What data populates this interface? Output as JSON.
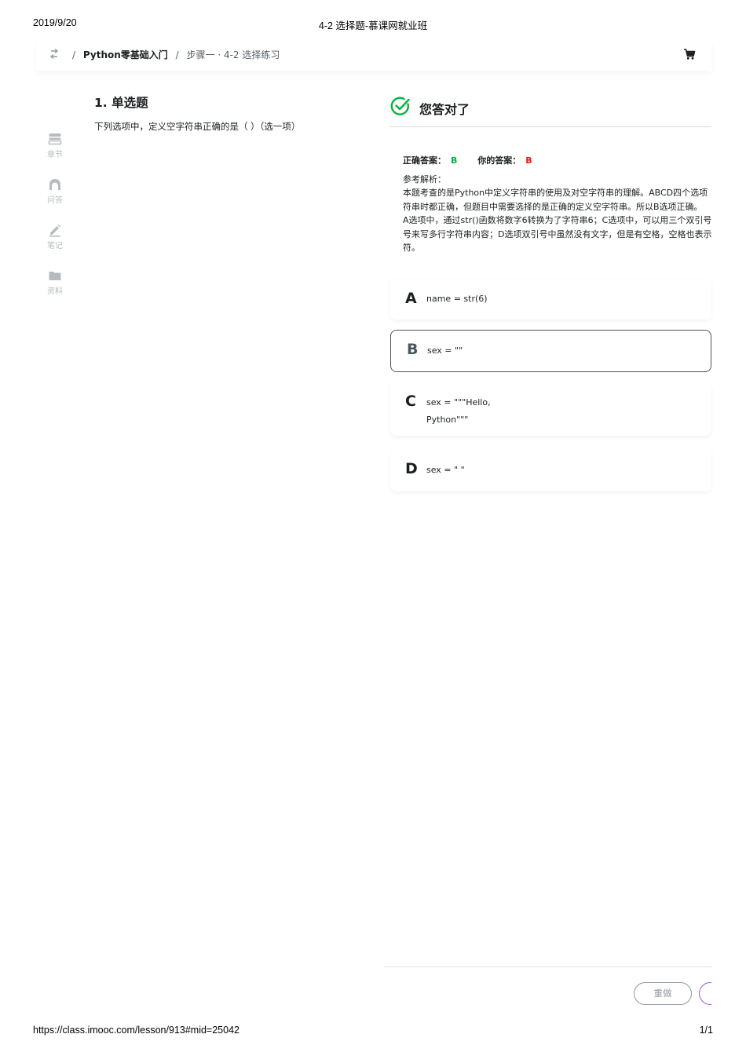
{
  "print_header": {
    "date": "2019/9/20",
    "title": "4-2 选择题-慕课网就业班"
  },
  "print_footer": {
    "url": "https://class.imooc.com/lesson/913#mid=25042",
    "page": "1/1"
  },
  "topbar": {
    "back_icon": "switch-arrows-icon",
    "separator": "/",
    "course": "Python零基础入门",
    "step": "步骤一 · 4-2 选择练习",
    "cart_icon": "cart-icon"
  },
  "sidebar": {
    "items": [
      {
        "icon": "chapter-icon",
        "label": "章节"
      },
      {
        "icon": "qa-icon",
        "label": "问答"
      },
      {
        "icon": "note-icon",
        "label": "笔记"
      },
      {
        "icon": "folder-icon",
        "label": "资料"
      }
    ]
  },
  "question": {
    "title": "1. 单选题",
    "text": "下列选项中，定义空字符串正确的是（ ）（选一项）"
  },
  "result": {
    "icon": "check-circle-icon",
    "text": "您答对了",
    "correct_label": "正确答案：",
    "correct_value": "B",
    "your_label": "你的答案：",
    "your_value": "B",
    "analysis_title": "参考解析：",
    "analysis_lines": [
      "本题考查的是Python中定义字符串的使用及对空字符串的理解。ABCD四个选项",
      "符串时都正确，但题目中需要选择的是正确的定义空字符串。所以B选项正确。",
      "A选项中，通过str()函数将数字6转换为了字符串6；C选项中，可以用三个双引号",
      "号来写多行字符串内容；D选项双引号中虽然没有文字，但是有空格，空格也表示",
      "符。"
    ]
  },
  "options": [
    {
      "letter": "A",
      "text": "name = str(6)",
      "selected": false
    },
    {
      "letter": "B",
      "text": "sex = \"\"",
      "selected": true
    },
    {
      "letter": "C",
      "text": "sex = \"\"\"Hello,\nPython\"\"\"",
      "selected": false
    },
    {
      "letter": "D",
      "text": "sex = \" \"",
      "selected": false
    }
  ],
  "footer_buttons": {
    "redo": "重做"
  },
  "colors": {
    "correct": "#00b43c",
    "wrong": "#f01414",
    "muted": "#b7bbbf",
    "next_border": "#a35bd6"
  }
}
